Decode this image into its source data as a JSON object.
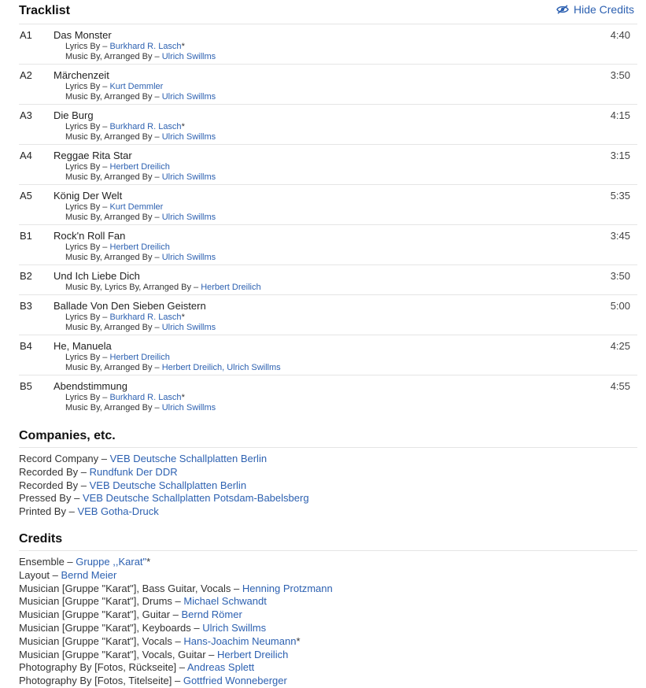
{
  "tracklist": {
    "heading": "Tracklist",
    "hide_credits_label": "Hide Credits",
    "tracks": [
      {
        "pos": "A1",
        "title": "Das Monster",
        "duration": "4:40",
        "credits": [
          {
            "role": "Lyrics By – ",
            "names": "Burkhard R. Lasch",
            "suffix": "*"
          },
          {
            "role": "Music By, Arranged By – ",
            "names": "Ulrich Swillms",
            "suffix": ""
          }
        ]
      },
      {
        "pos": "A2",
        "title": "Märchenzeit",
        "duration": "3:50",
        "credits": [
          {
            "role": "Lyrics By – ",
            "names": "Kurt Demmler",
            "suffix": ""
          },
          {
            "role": "Music By, Arranged By – ",
            "names": "Ulrich Swillms",
            "suffix": ""
          }
        ]
      },
      {
        "pos": "A3",
        "title": "Die Burg",
        "duration": "4:15",
        "credits": [
          {
            "role": "Lyrics By – ",
            "names": "Burkhard R. Lasch",
            "suffix": "*"
          },
          {
            "role": "Music By, Arranged By – ",
            "names": "Ulrich Swillms",
            "suffix": ""
          }
        ]
      },
      {
        "pos": "A4",
        "title": "Reggae Rita Star",
        "duration": "3:15",
        "credits": [
          {
            "role": "Lyrics By – ",
            "names": "Herbert Dreilich",
            "suffix": ""
          },
          {
            "role": "Music By, Arranged By – ",
            "names": "Ulrich Swillms",
            "suffix": ""
          }
        ]
      },
      {
        "pos": "A5",
        "title": "König Der Welt",
        "duration": "5:35",
        "credits": [
          {
            "role": "Lyrics By – ",
            "names": "Kurt Demmler",
            "suffix": ""
          },
          {
            "role": "Music By, Arranged By – ",
            "names": "Ulrich Swillms",
            "suffix": ""
          }
        ]
      },
      {
        "pos": "B1",
        "title": "Rock'n Roll Fan",
        "duration": "3:45",
        "credits": [
          {
            "role": "Lyrics By – ",
            "names": "Herbert Dreilich",
            "suffix": ""
          },
          {
            "role": "Music By, Arranged By – ",
            "names": "Ulrich Swillms",
            "suffix": ""
          }
        ]
      },
      {
        "pos": "B2",
        "title": "Und Ich Liebe Dich",
        "duration": "3:50",
        "credits": [
          {
            "role": "Music By, Lyrics By, Arranged By – ",
            "names": "Herbert Dreilich",
            "suffix": ""
          }
        ]
      },
      {
        "pos": "B3",
        "title": "Ballade Von Den Sieben Geistern",
        "duration": "5:00",
        "credits": [
          {
            "role": "Lyrics By – ",
            "names": "Burkhard R. Lasch",
            "suffix": "*"
          },
          {
            "role": "Music By, Arranged By – ",
            "names": "Ulrich Swillms",
            "suffix": ""
          }
        ]
      },
      {
        "pos": "B4",
        "title": "He, Manuela",
        "duration": "4:25",
        "credits": [
          {
            "role": "Lyrics By – ",
            "names": "Herbert Dreilich",
            "suffix": ""
          },
          {
            "role": "Music By, Arranged By – ",
            "names": "Herbert Dreilich, Ulrich Swillms",
            "suffix": ""
          }
        ]
      },
      {
        "pos": "B5",
        "title": "Abendstimmung",
        "duration": "4:55",
        "credits": [
          {
            "role": "Lyrics By – ",
            "names": "Burkhard R. Lasch",
            "suffix": "*"
          },
          {
            "role": "Music By, Arranged By – ",
            "names": "Ulrich Swillms",
            "suffix": ""
          }
        ]
      }
    ]
  },
  "companies": {
    "heading": "Companies, etc.",
    "items": [
      {
        "role": "Record Company – ",
        "name": "VEB Deutsche Schallplatten Berlin",
        "suffix": ""
      },
      {
        "role": "Recorded By – ",
        "name": "Rundfunk Der DDR",
        "suffix": ""
      },
      {
        "role": "Recorded By – ",
        "name": "VEB Deutsche Schallplatten Berlin",
        "suffix": ""
      },
      {
        "role": "Pressed By – ",
        "name": "VEB Deutsche Schallplatten Potsdam-Babelsberg",
        "suffix": ""
      },
      {
        "role": "Printed By – ",
        "name": "VEB Gotha-Druck",
        "suffix": ""
      }
    ]
  },
  "credits": {
    "heading": "Credits",
    "items": [
      {
        "role": "Ensemble – ",
        "name": "Gruppe ,,Karat\"",
        "suffix": "*"
      },
      {
        "role": "Layout – ",
        "name": "Bernd Meier",
        "suffix": ""
      },
      {
        "role": "Musician [Gruppe \"Karat\"], Bass Guitar, Vocals – ",
        "name": "Henning Protzmann",
        "suffix": ""
      },
      {
        "role": "Musician [Gruppe \"Karat\"], Drums – ",
        "name": "Michael Schwandt",
        "suffix": ""
      },
      {
        "role": "Musician [Gruppe \"Karat\"], Guitar – ",
        "name": "Bernd Römer",
        "suffix": ""
      },
      {
        "role": "Musician [Gruppe \"Karat\"], Keyboards – ",
        "name": "Ulrich Swillms",
        "suffix": ""
      },
      {
        "role": "Musician [Gruppe \"Karat\"], Vocals – ",
        "name": "Hans-Joachim Neumann",
        "suffix": "*"
      },
      {
        "role": "Musician [Gruppe \"Karat\"], Vocals, Guitar – ",
        "name": "Herbert Dreilich",
        "suffix": ""
      },
      {
        "role": "Photography By [Fotos, Rückseite] – ",
        "name": "Andreas Splett",
        "suffix": ""
      },
      {
        "role": "Photography By [Fotos, Titelseite] – ",
        "name": "Gottfried Wonneberger",
        "suffix": ""
      }
    ]
  },
  "colors": {
    "link": "#2d61b1",
    "divider": "#e5e5e5",
    "text": "#222222"
  },
  "icons": {
    "hide_credits": "eye-slash-icon"
  }
}
